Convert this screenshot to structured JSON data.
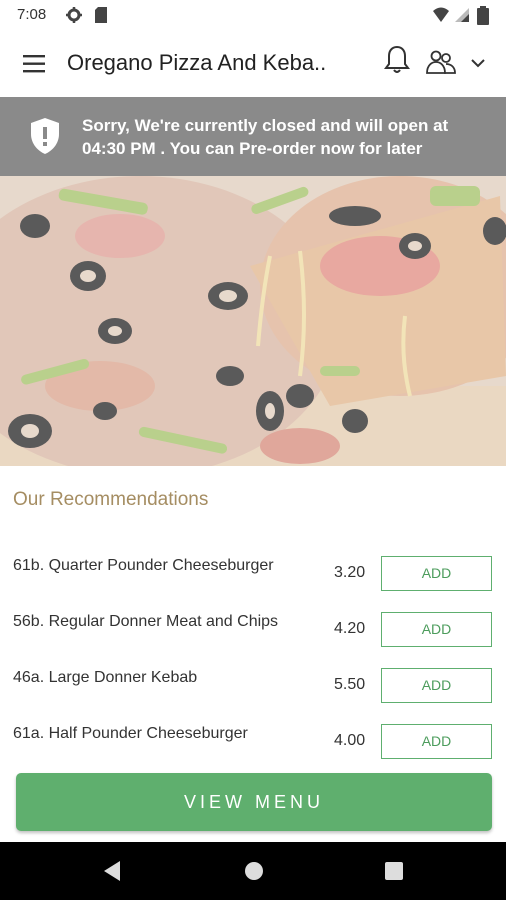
{
  "status_bar": {
    "time": "7:08"
  },
  "header": {
    "title": "Oregano Pizza And Keba.."
  },
  "banner": {
    "message": "Sorry, We're currently closed and will open at 04:30 PM . You can Pre-order now for later"
  },
  "recommendations": {
    "title": "Our Recommendations",
    "items": [
      {
        "name": "61b. Quarter Pounder Cheeseburger",
        "price": "3.20",
        "add_label": "ADD"
      },
      {
        "name": "56b. Regular Donner Meat and Chips",
        "price": "4.20",
        "add_label": "ADD"
      },
      {
        "name": "46a. Large Donner Kebab",
        "price": "5.50",
        "add_label": "ADD"
      },
      {
        "name": "61a. Half Pounder Cheeseburger",
        "price": "4.00",
        "add_label": "ADD"
      }
    ]
  },
  "footer": {
    "view_menu_label": "VIEW MENU"
  },
  "colors": {
    "accent_green": "#5faf6e",
    "banner_gray": "#8a8a8a",
    "section_title": "#a58d62"
  }
}
